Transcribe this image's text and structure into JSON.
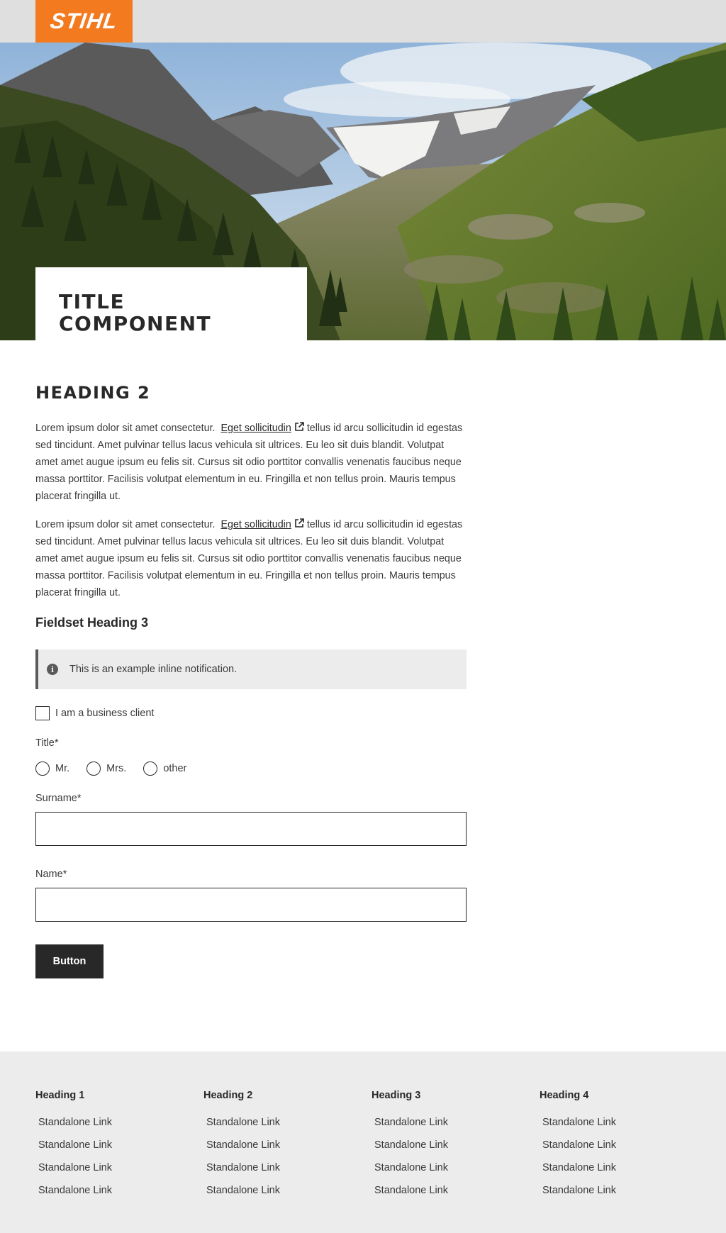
{
  "header": {
    "logo_text": "STIHL",
    "logo_color": "#f37a1f"
  },
  "hero": {
    "title": "TITLE COMPONENT"
  },
  "main": {
    "heading": "HEADING 2",
    "paragraphs": [
      {
        "before": "Lorem ipsum dolor sit amet consectetur.",
        "link": "Eget sollicitudin",
        "after": "tellus id arcu sollicitudin id egestas sed tincidunt. Amet pulvinar tellus lacus vehicula sit ultrices. Eu leo sit duis blandit. Volutpat amet amet augue ipsum eu felis sit. Cursus sit odio porttitor convallis venenatis faucibus neque massa porttitor. Facilisis volutpat elementum in eu. Fringilla et non tellus proin. Mauris tempus placerat fringilla ut."
      },
      {
        "before": "Lorem ipsum dolor sit amet consectetur.",
        "link": "Eget sollicitudin",
        "after": "tellus id arcu sollicitudin id egestas sed tincidunt. Amet pulvinar tellus lacus vehicula sit ultrices. Eu leo sit duis blandit. Volutpat amet amet augue ipsum eu felis sit. Cursus sit odio porttitor convallis venenatis faucibus neque massa porttitor. Facilisis volutpat elementum in eu. Fringilla et non tellus proin. Mauris tempus placerat fringilla ut."
      }
    ],
    "fieldset_heading": "Fieldset Heading 3",
    "notification": "This is an example inline notification.",
    "checkbox_label": "I am a business client",
    "title_label": "Title",
    "required_mark": "*",
    "radio_options": [
      "Mr.",
      "Mrs.",
      "other"
    ],
    "surname_label": "Surname",
    "surname_value": "",
    "name_label": "Name",
    "name_value": "",
    "button_label": "Button"
  },
  "footer": {
    "columns": [
      {
        "heading": "Heading 1",
        "links": [
          "Standalone Link",
          "Standalone Link",
          "Standalone Link",
          "Standalone Link"
        ]
      },
      {
        "heading": "Heading 2",
        "links": [
          "Standalone Link",
          "Standalone Link",
          "Standalone Link",
          "Standalone Link"
        ]
      },
      {
        "heading": "Heading 3",
        "links": [
          "Standalone Link",
          "Standalone Link",
          "Standalone Link",
          "Standalone Link"
        ]
      },
      {
        "heading": "Heading 4",
        "links": [
          "Standalone Link",
          "Standalone Link",
          "Standalone Link",
          "Standalone Link"
        ]
      }
    ]
  }
}
